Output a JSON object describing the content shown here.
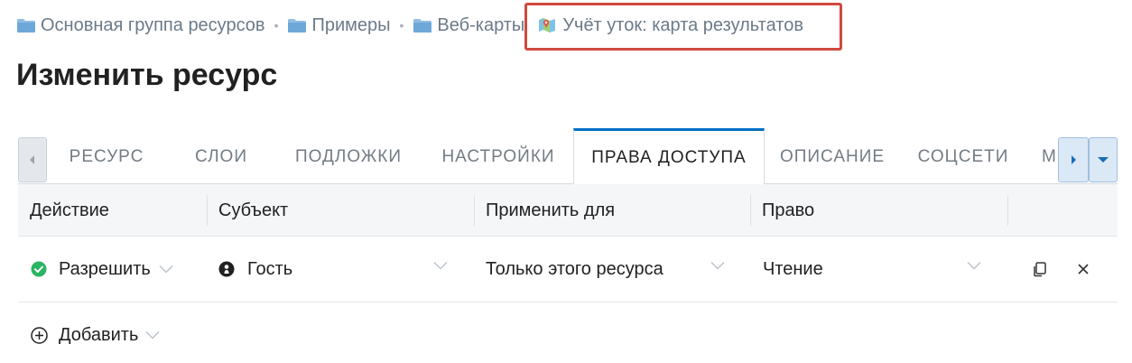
{
  "breadcrumb": {
    "items": [
      {
        "label": "Основная группа ресурсов",
        "icon": "folder-icon"
      },
      {
        "label": "Примеры",
        "icon": "folder-icon"
      },
      {
        "label": "Веб-карты",
        "icon": "folder-icon"
      }
    ],
    "separator": "•",
    "current": {
      "label": "Учёт уток: карта результатов",
      "icon": "map-icon"
    }
  },
  "page": {
    "title": "Изменить ресурс"
  },
  "tabs": {
    "items": [
      "РЕСУРС",
      "СЛОИ",
      "ПОДЛОЖКИ",
      "НАСТРОЙКИ",
      "ПРАВА ДОСТУПА",
      "ОПИСАНИЕ",
      "СОЦСЕТИ"
    ],
    "clipped": "М",
    "active": "ПРАВА ДОСТУПА",
    "accent_color": "#0070c5"
  },
  "table": {
    "headers": {
      "action": "Действие",
      "subject": "Субъект",
      "apply_to": "Применить для",
      "permission": "Право"
    },
    "rows": [
      {
        "action": "Разрешить",
        "action_icon": "check-circle-icon",
        "action_color": "#2ab562",
        "subject": "Гость",
        "subject_icon": "user-icon",
        "apply_to": "Только этого ресурса",
        "permission": "Чтение"
      }
    ]
  },
  "add": {
    "label": "Добавить",
    "icon": "plus-circle-icon"
  },
  "highlight_color": "#d04a3f"
}
